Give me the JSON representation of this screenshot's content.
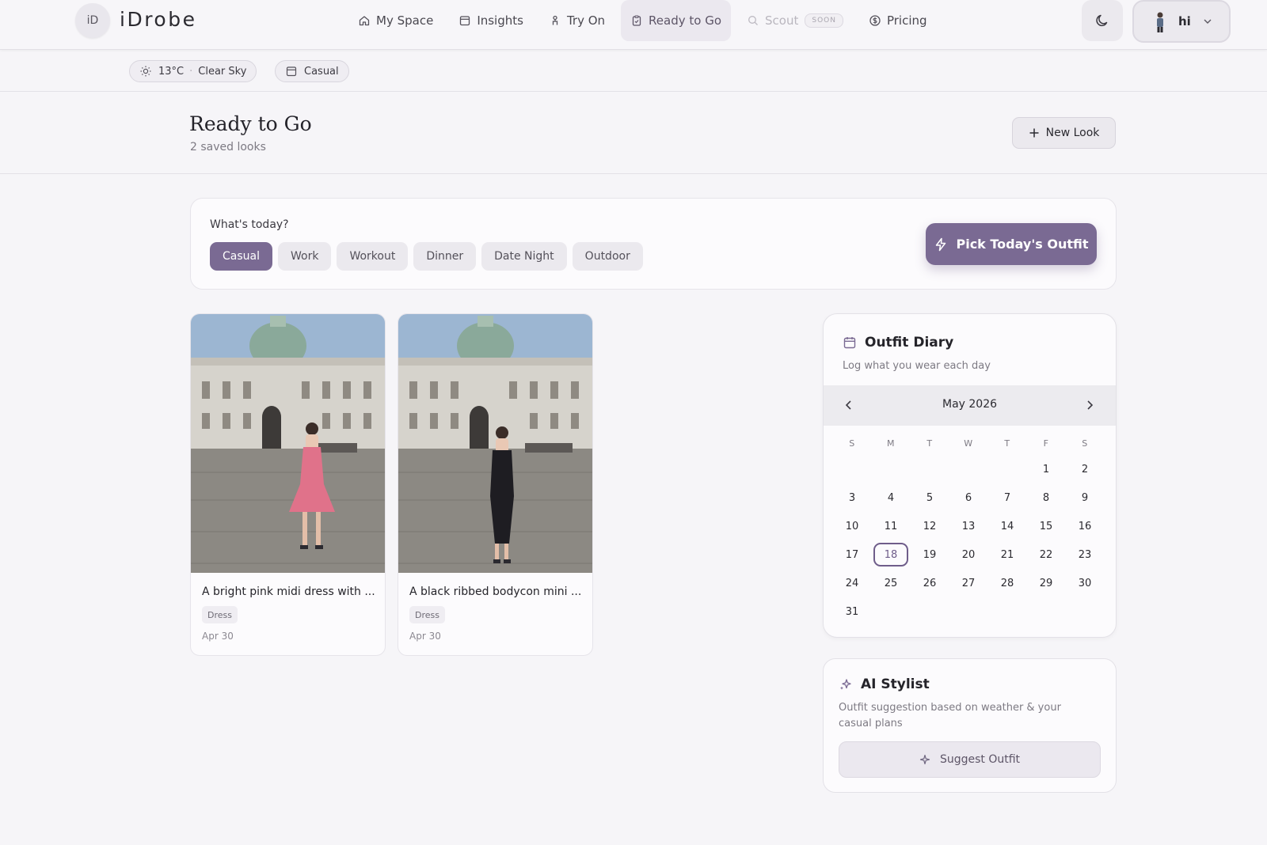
{
  "brand": {
    "badge": "iD",
    "name": "iDrobe"
  },
  "nav": {
    "items": [
      {
        "label": "My Space",
        "icon": "home-icon"
      },
      {
        "label": "Insights",
        "icon": "calendar-icon"
      },
      {
        "label": "Try On",
        "icon": "hanger-icon"
      },
      {
        "label": "Ready to Go",
        "icon": "clipboard-icon",
        "active": true
      },
      {
        "label": "Scout",
        "icon": "search-icon",
        "disabled": true,
        "badge": "SOON"
      },
      {
        "label": "Pricing",
        "icon": "dollar-icon"
      }
    ],
    "user_label": "hi"
  },
  "context": {
    "temperature": "13°C",
    "sky": "Clear Sky",
    "occasion": "Casual"
  },
  "header": {
    "title": "Ready to Go",
    "subtitle": "2 saved looks",
    "new_look_label": "New Look"
  },
  "occasion_picker": {
    "question": "What's today?",
    "options": [
      "Casual",
      "Work",
      "Workout",
      "Dinner",
      "Date Night",
      "Outdoor"
    ],
    "selected": "Casual",
    "pick_label": "Pick Today's Outfit"
  },
  "looks": [
    {
      "title": "A bright pink midi dress with ...",
      "tag": "Dress",
      "date": "Apr 30",
      "dress_color": "#e0728a"
    },
    {
      "title": "A black ribbed bodycon mini ...",
      "tag": "Dress",
      "date": "Apr 30",
      "dress_color": "#1e1d22"
    }
  ],
  "diary": {
    "title": "Outfit Diary",
    "subtitle": "Log what you wear each day",
    "month_label": "May 2026",
    "weekdays": [
      "S",
      "M",
      "T",
      "W",
      "T",
      "F",
      "S"
    ],
    "first_weekday": 5,
    "days_in_month": 31,
    "today": 18
  },
  "ai_stylist": {
    "title": "AI Stylist",
    "description": "Outfit suggestion based on weather & your casual plans",
    "button_label": "Suggest Outfit"
  },
  "colors": {
    "accent": "#7a6a93",
    "background": "#f6f5f8"
  }
}
